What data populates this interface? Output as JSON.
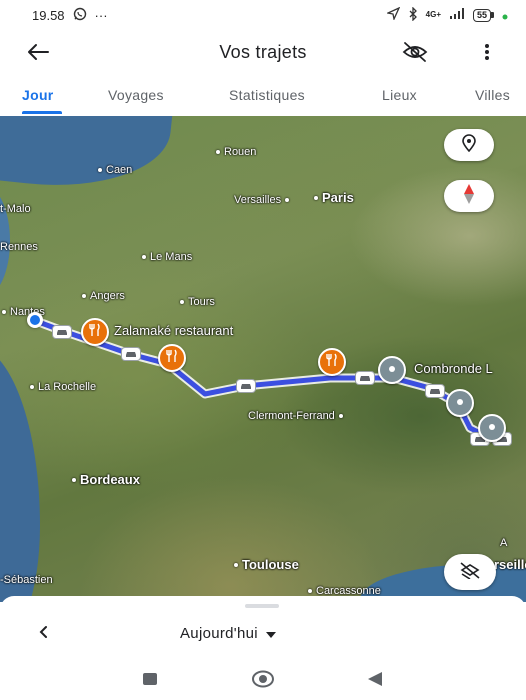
{
  "status_bar": {
    "time": "19.58",
    "whatsapp_icon": "whatsapp-icon",
    "more_notifications": "···",
    "network": "4G+",
    "battery": "55"
  },
  "app_bar": {
    "title": "Vos trajets",
    "back_icon": "arrow-back-icon",
    "location_off_icon": "location-off-icon",
    "menu_icon": "more-vert-icon"
  },
  "tabs": [
    {
      "label": "Jour",
      "active": true
    },
    {
      "label": "Voyages",
      "active": false
    },
    {
      "label": "Statistiques",
      "active": false
    },
    {
      "label": "Lieux",
      "active": false
    },
    {
      "label": "Villes",
      "active": false
    }
  ],
  "map": {
    "places": {
      "rouen": "Rouen",
      "caen": "Caen",
      "saint_malo": "t-Malo",
      "versailles": "Versailles",
      "paris": "Paris",
      "rennes": "Rennes",
      "le_mans": "Le Mans",
      "angers": "Angers",
      "tours": "Tours",
      "nantes": "Nantes",
      "la_rochelle": "La Rochelle",
      "clermont_ferrand": "Clermont-Ferrand",
      "bordeaux": "Bordeaux",
      "toulouse": "Toulouse",
      "carcassonne": "Carcassonne",
      "san_sebastian": "-Sébastien",
      "marseille": "rseille",
      "a_label": "A"
    },
    "pois": {
      "restaurant": "Zalamaké restaurant",
      "combronde": "Combronde L"
    },
    "route_color": "#3c4fe0",
    "icons": {
      "my_location": "location-pin-icon",
      "compass": "compass-icon",
      "hide_route": "layers-off-icon",
      "food": "fork-knife-icon",
      "car": "car-icon",
      "pin": "place-pin-icon"
    }
  },
  "sheet": {
    "date_label": "Aujourd'hui",
    "prev_icon": "chevron-left-icon",
    "dropdown_icon": "caret-down-icon"
  },
  "nav_bar": {
    "recents_icon": "recents-icon",
    "home_icon": "home-icon",
    "back_icon": "nav-back-icon"
  }
}
